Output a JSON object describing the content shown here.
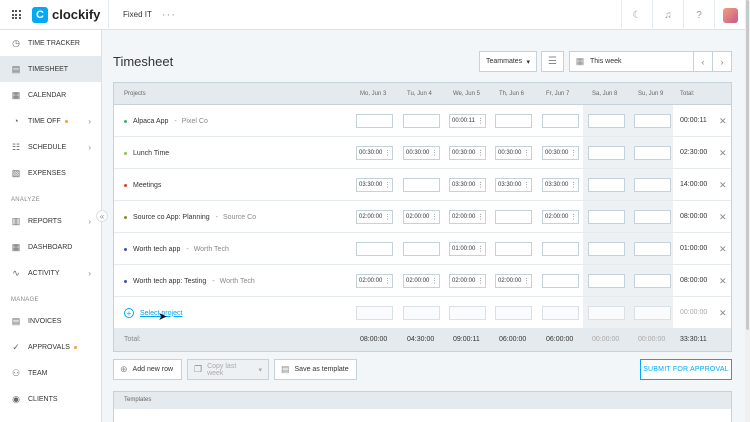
{
  "header": {
    "logo_text": "clockify",
    "workspace": "Fixed IT",
    "more": "···"
  },
  "sidebar": {
    "items": [
      {
        "label": "TIME TRACKER",
        "icon": "clock-icon"
      },
      {
        "label": "TIMESHEET",
        "icon": "timesheet-icon",
        "active": true
      },
      {
        "label": "CALENDAR",
        "icon": "calendar-icon"
      },
      {
        "label": "TIME OFF",
        "icon": "time-off-icon",
        "dot": true,
        "chevron": true
      },
      {
        "label": "SCHEDULE",
        "icon": "schedule-icon",
        "chevron": true
      },
      {
        "label": "EXPENSES",
        "icon": "expenses-icon"
      }
    ],
    "analyze_label": "ANALYZE",
    "analyze_items": [
      {
        "label": "REPORTS",
        "icon": "reports-icon",
        "chevron": true
      },
      {
        "label": "DASHBOARD",
        "icon": "dashboard-icon"
      },
      {
        "label": "ACTIVITY",
        "icon": "activity-icon",
        "chevron": true
      }
    ],
    "manage_label": "MANAGE",
    "manage_items": [
      {
        "label": "INVOICES",
        "icon": "invoices-icon"
      },
      {
        "label": "APPROVALS",
        "icon": "approvals-icon",
        "dot": true
      },
      {
        "label": "TEAM",
        "icon": "team-icon"
      },
      {
        "label": "CLIENTS",
        "icon": "clients-icon"
      },
      {
        "label": "PROJECTS",
        "icon": "projects-icon"
      }
    ]
  },
  "page": {
    "title": "Timesheet",
    "teammates": "Teammates",
    "week": "This week"
  },
  "table": {
    "projects_header": "Projects",
    "days": [
      "Mo, Jun 3",
      "Tu, Jun 4",
      "We, Jun 5",
      "Th, Jun 6",
      "Fr, Jun 7",
      "Sa, Jun 8",
      "Su, Jun 9"
    ],
    "total_header": "Total:",
    "rows": [
      {
        "project": "Alpaca App",
        "client": "Pixel Co",
        "color": "#3cb371",
        "cells": [
          "",
          "",
          "00:00:11",
          "",
          "",
          "",
          ""
        ],
        "total": "00:00:11"
      },
      {
        "project": "Lunch Time",
        "client": "",
        "color": "#8bc34a",
        "cells": [
          "00:30:00",
          "00:30:00",
          "00:30:00",
          "00:30:00",
          "00:30:00",
          "",
          ""
        ],
        "total": "02:30:00"
      },
      {
        "project": "Meetings",
        "client": "",
        "color": "#e53935",
        "cells": [
          "03:30:00",
          "",
          "03:30:00",
          "03:30:00",
          "03:30:00",
          "",
          ""
        ],
        "total": "14:00:00"
      },
      {
        "project": "Source co App: Planning",
        "client": "Source Co",
        "color": "#8d8b2a",
        "cells": [
          "02:00:00",
          "02:00:00",
          "02:00:00",
          "",
          "02:00:00",
          "",
          ""
        ],
        "total": "08:00:00"
      },
      {
        "project": "Worth tech app",
        "client": "Worth Tech",
        "color": "#3f51b5",
        "cells": [
          "",
          "",
          "01:00:00",
          "",
          "",
          "",
          ""
        ],
        "total": "01:00:00"
      },
      {
        "project": "Worth tech app: Testing",
        "client": "Worth Tech",
        "color": "#3f51b5",
        "cells": [
          "02:00:00",
          "02:00:00",
          "02:00:00",
          "02:00:00",
          "",
          "",
          ""
        ],
        "total": "08:00:00"
      }
    ],
    "select_project": "Select project",
    "empty_total": "00:00:00",
    "footer_label": "Total:",
    "footer_totals": [
      "08:00:00",
      "04:30:00",
      "09:00:11",
      "06:00:00",
      "06:00:00",
      "00:00:00",
      "00:00:00"
    ],
    "grand_total": "33:30:11"
  },
  "actions": {
    "add_row": "Add new row",
    "copy_week": "Copy last week",
    "save_template": "Save as template",
    "submit": "SUBMIT FOR APPROVAL"
  },
  "templates": {
    "header": "Templates"
  }
}
